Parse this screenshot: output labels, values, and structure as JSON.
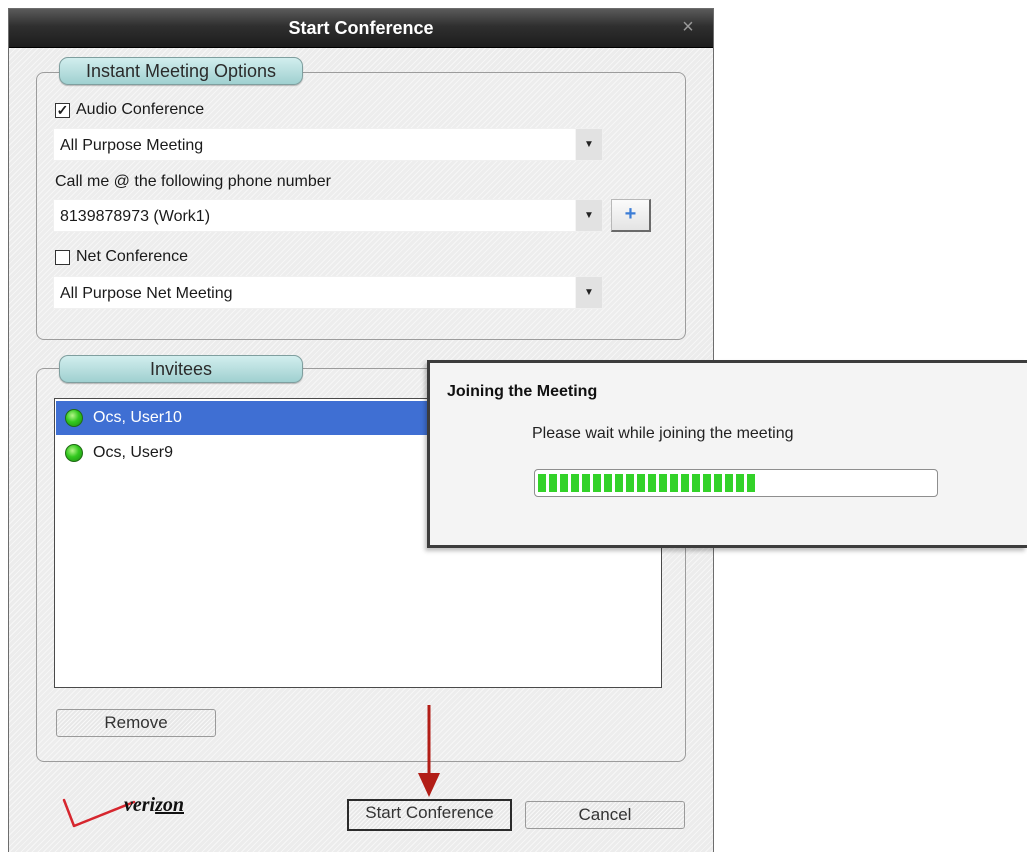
{
  "window": {
    "title": "Start Conference",
    "close_symbol": "×"
  },
  "options": {
    "legend": "Instant Meeting Options",
    "audio_conference": {
      "label": "Audio Conference",
      "checked": true
    },
    "audio_meeting_type": {
      "value": "All Purpose Meeting",
      "arrow": "▼"
    },
    "call_me_label": "Call me @ the following phone number",
    "phone": {
      "value": "8139878973 (Work1)",
      "arrow": "▼"
    },
    "add_phone_label": "+",
    "net_conference": {
      "label": "Net Conference",
      "checked": false
    },
    "net_meeting_type": {
      "value": "All Purpose Net Meeting",
      "arrow": "▼"
    }
  },
  "invitees": {
    "legend": "Invitees",
    "list": [
      {
        "name": "Ocs, User10",
        "selected": true,
        "status_color": "#33c91f"
      },
      {
        "name": "Ocs, User9",
        "selected": false,
        "status_color": "#33c91f"
      }
    ],
    "remove_label": "Remove"
  },
  "footer": {
    "logo_text_a": "veri",
    "logo_text_b": "zon",
    "start_label": "Start Conference",
    "cancel_label": "Cancel"
  },
  "popup": {
    "title": "Joining the Meeting",
    "message": "Please wait while joining the meeting",
    "progress": 0.55
  },
  "colors": {
    "selection": "#3f6fd3",
    "progress": "#33d229",
    "arrow": "#b21d16",
    "logo_check": "#d6262e"
  }
}
